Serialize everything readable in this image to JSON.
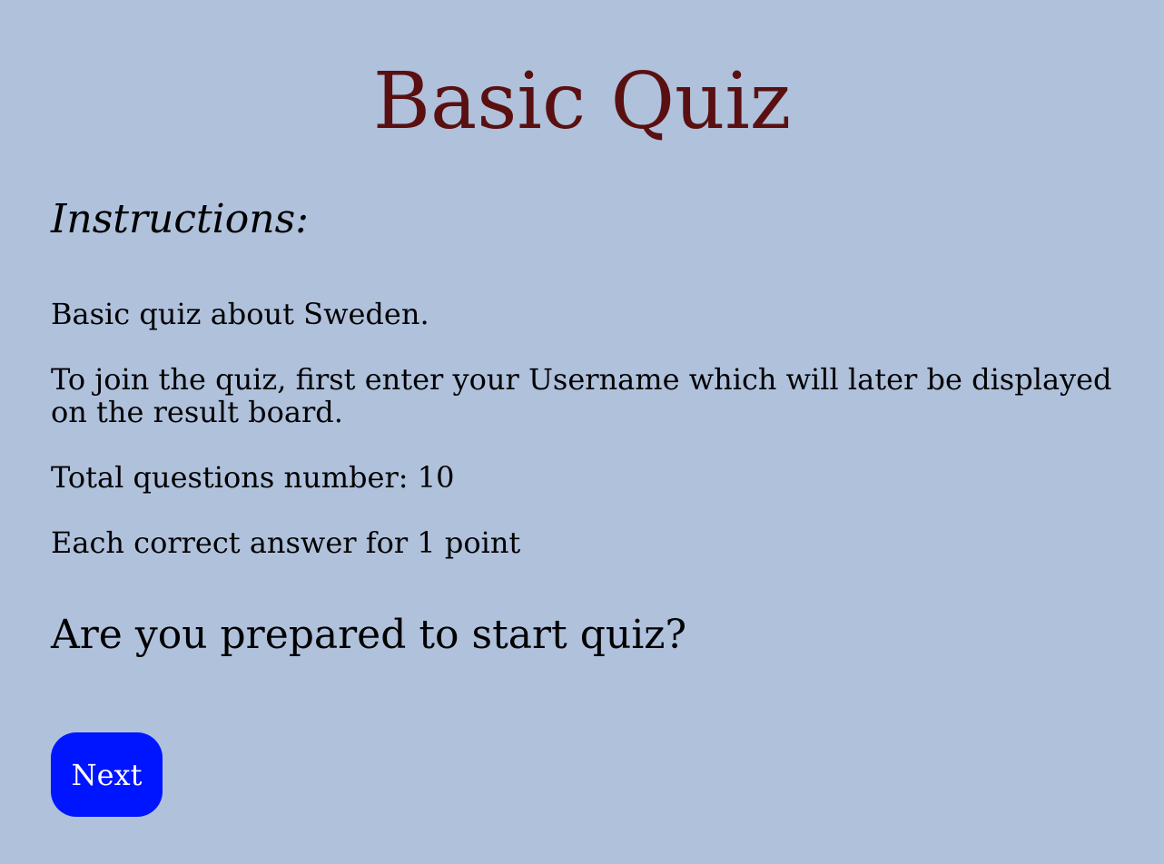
{
  "page": {
    "title": "Basic Quiz",
    "instructions_heading": "Instructions:",
    "paragraphs": [
      "Basic quiz about Sweden.",
      "To join the quiz, first enter your Username which will later be displayed on the result board.",
      "Total questions number: 10",
      "Each correct answer for 1 point"
    ],
    "prompt": "Are you prepared to start quiz?",
    "next_label": "Next"
  },
  "colors": {
    "background": "#b0c1dc",
    "title": "#5a1010",
    "button": "#0015ff",
    "button_text": "#ffffff"
  }
}
